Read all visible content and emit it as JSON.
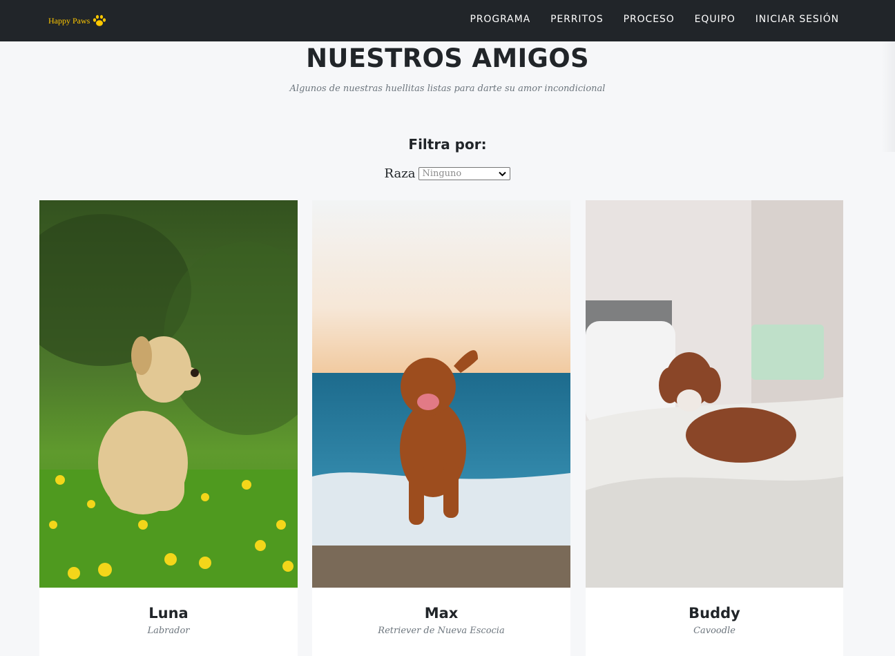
{
  "navbar": {
    "brand": "Happy Paws",
    "links": [
      "PROGRAMA",
      "PERRITOS",
      "PROCESO",
      "EQUIPO",
      "INICIAR SESIÓN"
    ]
  },
  "section": {
    "title": "NUESTROS AMIGOS",
    "subtitle": "Algunos de nuestras huellitas listas para darte su amor incondicional"
  },
  "filter": {
    "title": "Filtra por:",
    "label": "Raza",
    "selected": "Ninguno"
  },
  "dogs": [
    {
      "name": "Luna",
      "breed": "Labrador"
    },
    {
      "name": "Max",
      "breed": "Retriever de Nueva Escocia"
    },
    {
      "name": "Buddy",
      "breed": "Cavoodle"
    }
  ],
  "colors": {
    "navbar_bg": "#212529",
    "brand": "#ffc800",
    "page_bg": "#f6f7f9",
    "muted_text": "#6c757d"
  },
  "icons": {
    "brand": "paw-icon",
    "select": "chevron-down-icon"
  }
}
